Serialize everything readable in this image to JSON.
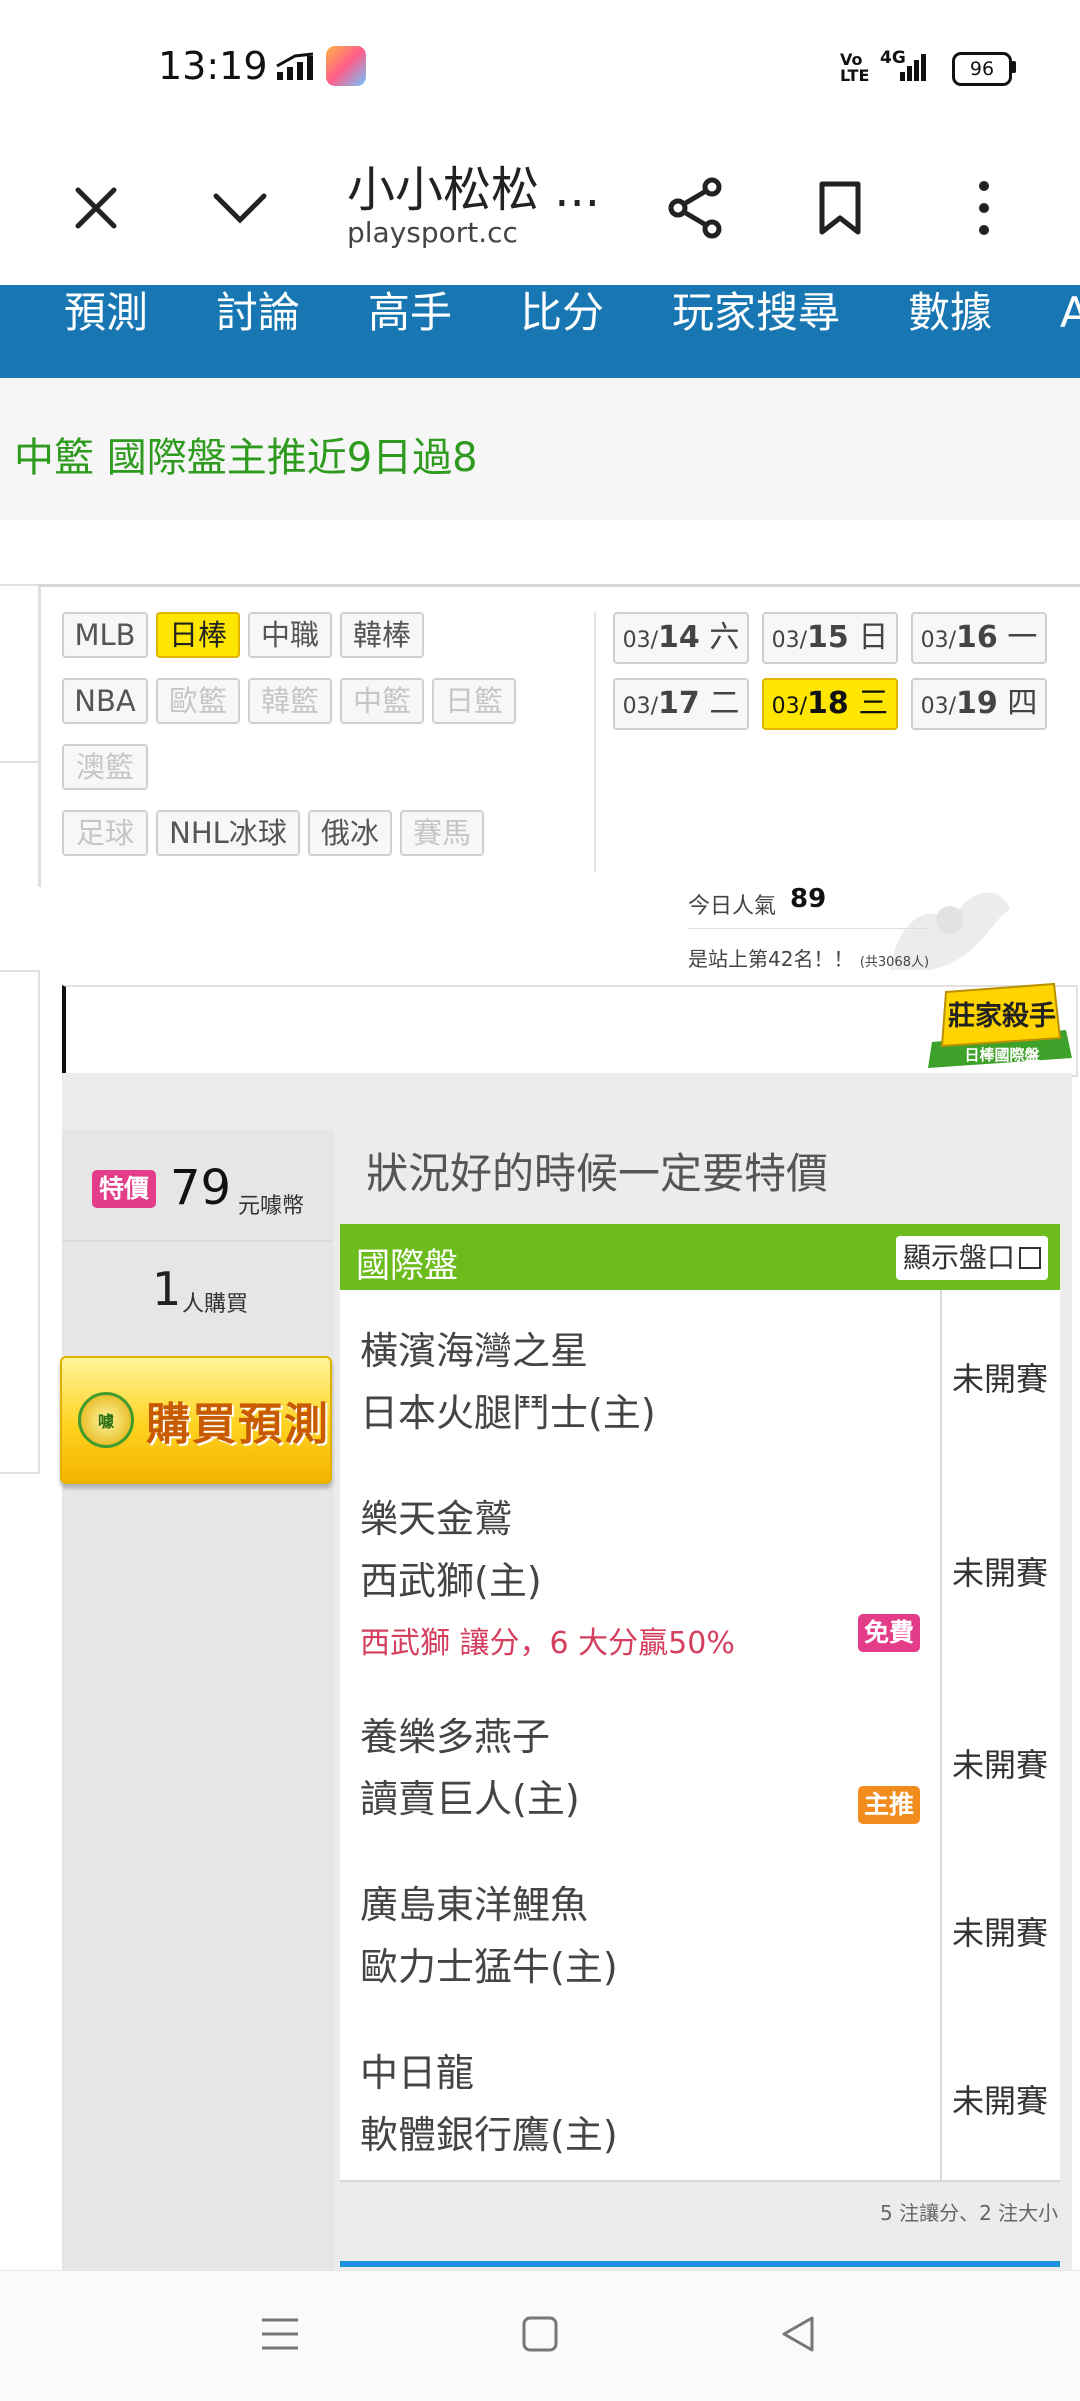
{
  "status_bar": {
    "time": "13:19",
    "volte": "Vo LTE",
    "network": "4G",
    "battery": "96",
    "icons": [
      "signal-speed-icon",
      "app-notification-icon",
      "cell-signal-icon",
      "battery-icon"
    ]
  },
  "browser": {
    "title": "小小松松 ...",
    "url": "playsport.cc",
    "icons": [
      "close-icon",
      "chevron-down-icon",
      "share-icon",
      "bookmark-icon",
      "more-vert-icon"
    ]
  },
  "nav": {
    "items": [
      "預測",
      "討論",
      "高手",
      "比分",
      "玩家搜尋",
      "數據",
      "A"
    ]
  },
  "promo": {
    "text": "中籃 國際盤主推近9日過8"
  },
  "leagues": {
    "row1": [
      "MLB",
      "日棒",
      "中職",
      "韓棒"
    ],
    "row2": [
      "NBA",
      "歐籃",
      "韓籃",
      "中籃",
      "日籃"
    ],
    "row3": [
      "澳籃"
    ],
    "row4": [
      "足球",
      "NHL冰球",
      "俄冰",
      "賽馬"
    ],
    "active": "日棒"
  },
  "dates": [
    {
      "md": "03/",
      "day": "14",
      "wd": "六"
    },
    {
      "md": "03/",
      "day": "15",
      "wd": "日"
    },
    {
      "md": "03/",
      "day": "16",
      "wd": "一"
    },
    {
      "md": "03/",
      "day": "17",
      "wd": "二"
    },
    {
      "md": "03/",
      "day": "18",
      "wd": "三"
    },
    {
      "md": "03/",
      "day": "19",
      "wd": "四"
    }
  ],
  "popularity": {
    "label": "今日人氣",
    "value": "89",
    "rank_text": "是站上第42名！！",
    "rank_total": "(共3068人)"
  },
  "banner": {
    "badge_title": "莊家殺手",
    "badge_sub": "日棒國際盤"
  },
  "offer": {
    "special_label": "特價",
    "price": "79",
    "price_unit": "元噱幣",
    "buyers": "1",
    "buyers_unit": "人購買",
    "buy_label": "購買預測",
    "coin_label": "噱",
    "slogan": "狀況好的時候一定要特價"
  },
  "table": {
    "title": "國際盤",
    "show_button": "顯示盤口",
    "rows": [
      {
        "away": "橫濱海灣之星",
        "home": "日本火腿鬥士(主)",
        "status": "未開賽",
        "note": "",
        "tag": ""
      },
      {
        "away": "樂天金鷲",
        "home": "西武獅(主)",
        "status": "未開賽",
        "note": "西武獅 讓分，6 大分贏50%",
        "tag": "免費"
      },
      {
        "away": "養樂多燕子",
        "home": "讀賣巨人(主)",
        "status": "未開賽",
        "note": "",
        "tag": "主推"
      },
      {
        "away": "廣島東洋鯉魚",
        "home": "歐力士猛牛(主)",
        "status": "未開賽",
        "note": "",
        "tag": ""
      },
      {
        "away": "中日龍",
        "home": "軟體銀行鷹(主)",
        "status": "未開賽",
        "note": "",
        "tag": ""
      }
    ],
    "footer": "5 注讓分、2 注大小"
  },
  "bottom_nav": {
    "icons": [
      "menu-icon",
      "home-square-icon",
      "back-triangle-icon"
    ]
  }
}
